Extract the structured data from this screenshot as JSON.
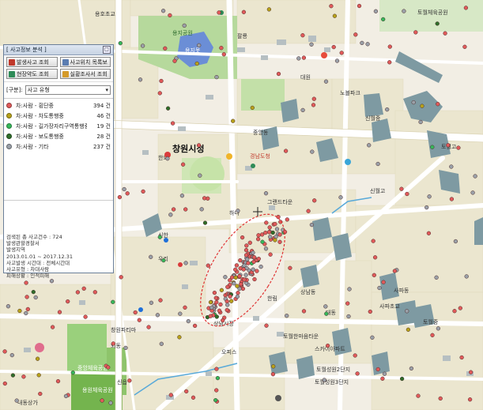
{
  "panel": {
    "title": "[ 사고정보 분석 ]",
    "close_label": "□",
    "buttons": [
      {
        "label": "발생사고 조회",
        "icon": "accident-icon"
      },
      {
        "label": "사고위치 목록보",
        "icon": "list-icon"
      },
      {
        "label": "현장약도 조회",
        "icon": "sketch-icon"
      },
      {
        "label": "실황조사서 조회",
        "icon": "report-icon"
      }
    ],
    "filter_label": "[구분]:",
    "filter_value": "사고 유형",
    "legend": [
      {
        "label": "차:사람 - 횡단중",
        "count": "394 건",
        "color": "#e05a5a"
      },
      {
        "label": "차:사람 - 차도통행중",
        "count": "46 건",
        "color": "#b7a21a"
      },
      {
        "label": "차:사람 - 길가장자리구역통행중",
        "count": "19 건",
        "color": "#36b85a"
      },
      {
        "label": "차:사람 - 보도통행중",
        "count": "28 건",
        "color": "#2f6e2a"
      },
      {
        "label": "차:사람 - 기타",
        "count": "237 건",
        "color": "#9aa0a8"
      }
    ],
    "summary": [
      "검색된 총 사고건수 : 724",
      "발생관할경찰서",
      "발생지역",
      "2013.01.01 ~ 2017.12.31",
      "사고발생 시간대 : 전체시간대",
      "사고유형 : 차대사람",
      "피해상황 : 인적피해"
    ]
  },
  "map": {
    "center_label": "창원시청",
    "labels": {
      "park1": "용지공원",
      "lake": "용지못",
      "park2": "토월체육공원",
      "park3": "중앙체육공원",
      "park4": "용원체육공원",
      "school1": "용호초교",
      "school2": "신월중",
      "school3": "사파초교",
      "school4": "토월중",
      "school5": "신월고",
      "apt1": "그랜드타운",
      "apt2": "토월한마음타운",
      "apt3": "스카이아파트",
      "apt4": "토월성원2단지",
      "apt5": "토월성원3단지",
      "etc1": "한화",
      "etc2": "중앙동",
      "etc3": "신한",
      "etc4": "우리",
      "etc5": "상남동",
      "etc6": "대동",
      "etc7": "한림",
      "etc8": "하나",
      "etc9": "경남도청",
      "etc10": "상남시장",
      "etc11": "팔룡",
      "etc12": "오피스",
      "etc13": "외동",
      "etc14": "신읍",
      "etc15": "창원파티마",
      "etc16": "내동상가",
      "etc17": "사파동",
      "etc18": "대원",
      "etc19": "노블파크",
      "etc20": "토월고"
    }
  },
  "colors": {
    "road_main": "#ffffff",
    "park": "#b9dca0",
    "water": "#6d8fd4",
    "block": "#e9e2cc",
    "building": "#7f9aa3"
  }
}
